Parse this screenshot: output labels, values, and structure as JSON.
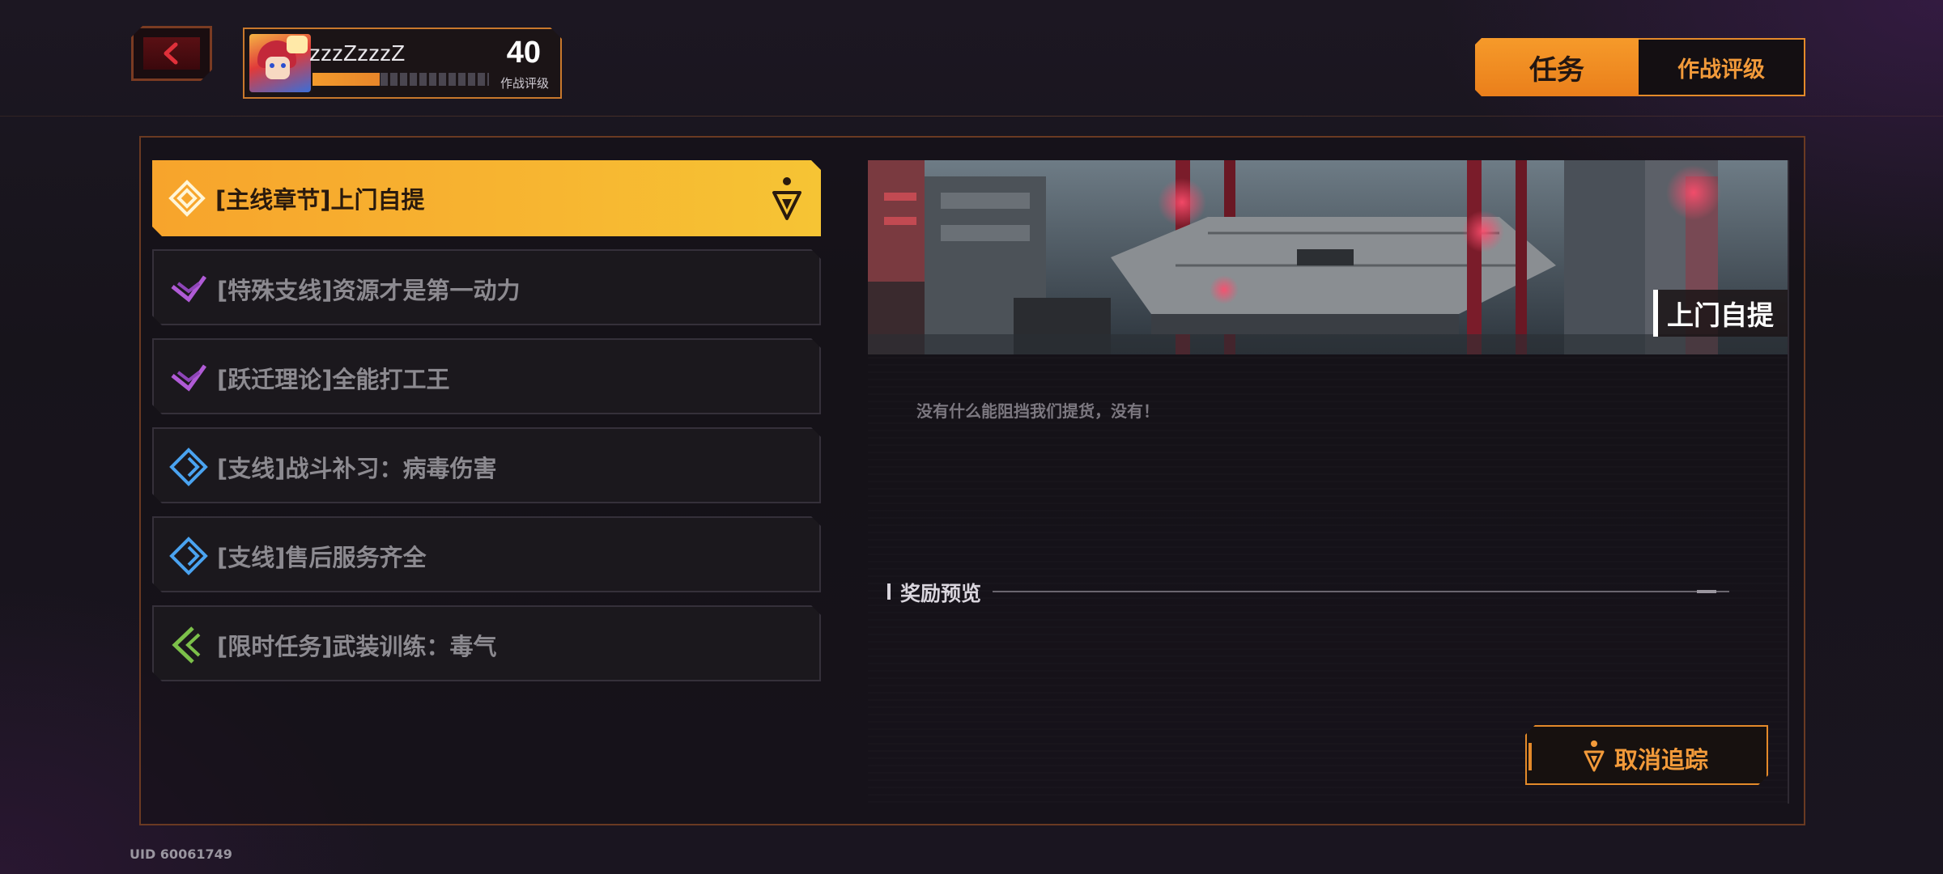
{
  "header": {
    "player_name": "zzzZzzzZ",
    "level": "40",
    "level_label": "作战评级",
    "xp_progress": 0.38
  },
  "tabs": [
    {
      "label": "任务",
      "active": true
    },
    {
      "label": "作战评级",
      "active": false
    }
  ],
  "quests": [
    {
      "label": "[主线章节]上门自提",
      "type": "main",
      "icon": "main-quest-icon",
      "color": "#f6c434",
      "active": true,
      "tracked": true
    },
    {
      "label": "[特殊支线]资源才是第一动力",
      "type": "special",
      "icon": "special-quest-icon",
      "color": "#b05bd6",
      "active": false
    },
    {
      "label": "[跃迁理论]全能打工王",
      "type": "warp",
      "icon": "warp-quest-icon",
      "color": "#b05bd6",
      "active": false
    },
    {
      "label": "[支线]战斗补习：病毒伤害",
      "type": "side",
      "icon": "side-quest-icon",
      "color": "#4aa3f0",
      "active": false
    },
    {
      "label": "[支线]售后服务齐全",
      "type": "side",
      "icon": "side-quest-icon",
      "color": "#4aa3f0",
      "active": false
    },
    {
      "label": "[限时任务]武装训练：毒气",
      "type": "limited",
      "icon": "limited-quest-icon",
      "color": "#7cc04a",
      "active": false
    }
  ],
  "detail": {
    "banner_title": "上门自提",
    "description": "没有什么能阻挡我们提货，没有！",
    "reward_heading": "奖励预览",
    "untrack_label": "取消追踪"
  },
  "footer": {
    "uid": "UID 60061749"
  },
  "colors": {
    "accent": "#f29a3a",
    "active_quest": "#f7b631"
  }
}
